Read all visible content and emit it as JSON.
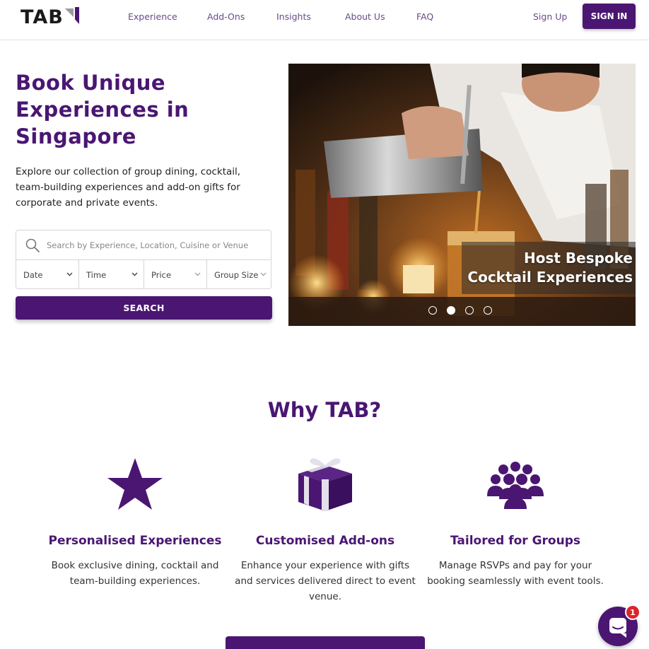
{
  "brand": {
    "name": "TAB",
    "accent": "#4a1672"
  },
  "nav": {
    "items": [
      "Experience",
      "Add-Ons",
      "Insights",
      "About Us",
      "FAQ"
    ],
    "signup": "Sign Up",
    "signin": "SIGN IN"
  },
  "hero": {
    "title": "Book Unique Experiences in Singapore",
    "description": "Explore our collection of group dining, cocktail, team-building experiences and add-on gifts for corporate and private events.",
    "search_placeholder": "Search by Experience, Location, Cuisine or Venue",
    "filters": [
      "Date",
      "Time",
      "Price",
      "Group Size"
    ],
    "search_button": "SEARCH"
  },
  "carousel": {
    "caption_line1": "Host Bespoke",
    "caption_line2": "Cocktail Experiences",
    "slide_count": 4,
    "active_index": 1
  },
  "why": {
    "title": "Why TAB?",
    "features": [
      {
        "icon": "star-icon",
        "title": "Personalised Experiences",
        "description": "Book exclusive dining, cocktail and team-building experiences."
      },
      {
        "icon": "gift-icon",
        "title": "Customised Add-ons",
        "description": "Enhance your experience with gifts and services delivered direct to event venue."
      },
      {
        "icon": "group-icon",
        "title": "Tailored for Groups",
        "description": "Manage RSVPs and pay for your booking seamlessly with event tools."
      }
    ]
  },
  "chat": {
    "badge_count": "1"
  }
}
